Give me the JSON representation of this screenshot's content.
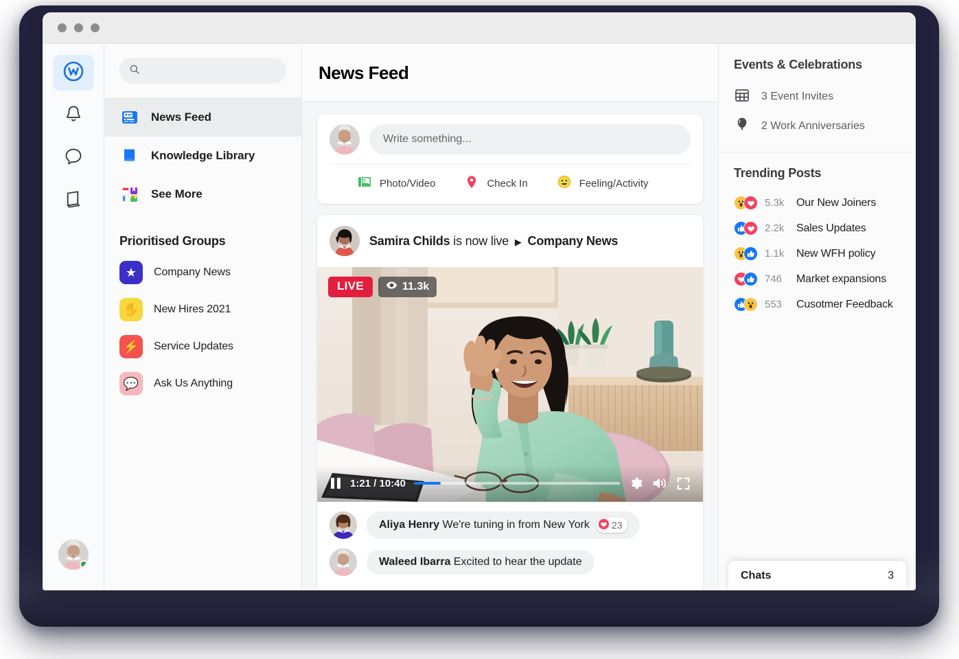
{
  "window": {
    "traffic_lights": [
      "close",
      "minimize",
      "maximize"
    ]
  },
  "icon_rail": {
    "items": [
      {
        "name": "workplace-logo",
        "icon": "workplace-w-icon",
        "active": true
      },
      {
        "name": "notifications",
        "icon": "bell-icon",
        "active": false
      },
      {
        "name": "chat",
        "icon": "chat-bubble-icon",
        "active": false
      },
      {
        "name": "knowledge",
        "icon": "book-icon",
        "active": false
      }
    ],
    "avatar_status": "online"
  },
  "search": {
    "placeholder": "",
    "value": "",
    "icon": "search-icon"
  },
  "nav": {
    "items": [
      {
        "label": "News Feed",
        "icon": "news-feed-icon",
        "active": true
      },
      {
        "label": "Knowledge Library",
        "icon": "book-blue-icon",
        "active": false
      },
      {
        "label": "See More",
        "icon": "apps-grid-icon",
        "active": false
      }
    ]
  },
  "groups": {
    "title": "Prioritised Groups",
    "items": [
      {
        "label": "Company News",
        "glyph": "★",
        "bg": "#3b2fc9",
        "fg": "#ffffff"
      },
      {
        "label": "New Hires 2021",
        "glyph": "✋",
        "bg": "#f7d83c",
        "fg": "#1c1e21"
      },
      {
        "label": "Service Updates",
        "glyph": "⚡",
        "bg": "#f4534d",
        "fg": "#ffffff"
      },
      {
        "label": "Ask Us Anything",
        "glyph": "💬",
        "bg": "#f6b8bd",
        "fg": "#1c1e21"
      }
    ]
  },
  "header": {
    "title": "News Feed"
  },
  "composer": {
    "placeholder": "Write something...",
    "value": "",
    "actions": [
      {
        "label": "Photo/Video",
        "icon": "photo-video-icon",
        "color": "#45bd62"
      },
      {
        "label": "Check In",
        "icon": "location-pin-icon",
        "color": "#f3425f"
      },
      {
        "label": "Feeling/Activity",
        "icon": "smiley-face-icon",
        "color": "#f7b928"
      }
    ]
  },
  "live_post": {
    "author": "Samira Childs",
    "status_text": "is now live",
    "arrow": "▶",
    "group": "Company News",
    "live_badge": "LIVE",
    "viewers": "11.3k",
    "viewers_icon": "eye-icon",
    "current_time": "1:21",
    "separator": "/",
    "duration": "10:40",
    "progress_percent": 13,
    "controls": [
      {
        "name": "pause-button",
        "icon": "pause-icon"
      },
      {
        "name": "settings-button",
        "icon": "gear-icon"
      },
      {
        "name": "volume-button",
        "icon": "speaker-icon"
      },
      {
        "name": "fullscreen-button",
        "icon": "fullscreen-icon"
      }
    ]
  },
  "comments": [
    {
      "author": "Aliya Henry",
      "text": "We're tuning in from New York",
      "reaction_icon": "heart-icon",
      "reaction_count": "23"
    },
    {
      "author": "Waleed Ibarra",
      "text": "Excited to hear the update",
      "reaction_icon": "",
      "reaction_count": ""
    }
  ],
  "events": {
    "title": "Events & Celebrations",
    "items": [
      {
        "label": "3 Event Invites",
        "icon": "calendar-icon"
      },
      {
        "label": "2 Work Anniversaries",
        "icon": "balloon-icon"
      }
    ]
  },
  "trending": {
    "title": "Trending Posts",
    "items": [
      {
        "count": "5.3k",
        "label": "Our New Joiners",
        "reactions": [
          "wow",
          "love"
        ]
      },
      {
        "count": "2.2k",
        "label": "Sales Updates",
        "reactions": [
          "like",
          "love"
        ]
      },
      {
        "count": "1.1k",
        "label": "New WFH policy",
        "reactions": [
          "wow",
          "like"
        ]
      },
      {
        "count": "746",
        "label": "Market expansions",
        "reactions": [
          "love",
          "like"
        ]
      },
      {
        "count": "553",
        "label": "Cusotmer Feedback",
        "reactions": [
          "like",
          "wow"
        ]
      }
    ]
  },
  "chats": {
    "label": "Chats",
    "count": "3"
  },
  "colors": {
    "brand_blue": "#1877f2",
    "live_red": "#e41e3f",
    "online_green": "#31a24c",
    "frame_navy": "#22223c"
  }
}
